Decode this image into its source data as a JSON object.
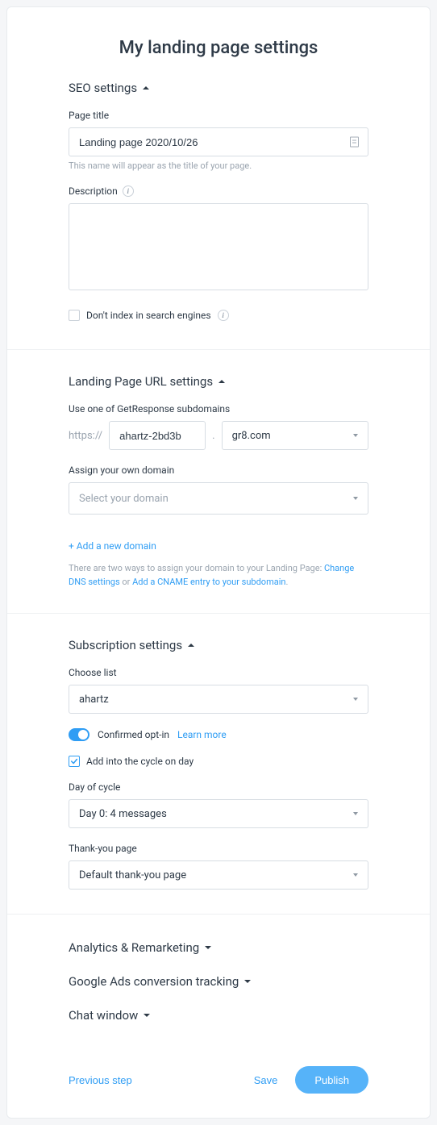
{
  "page_title": "My landing page settings",
  "seo": {
    "heading": "SEO settings",
    "page_title_label": "Page title",
    "page_title_value": "Landing page 2020/10/26",
    "page_title_hint": "This name will appear as the title of your page.",
    "description_label": "Description",
    "description_value": "",
    "noindex_label": "Don't index in search engines",
    "noindex_checked": false
  },
  "url": {
    "heading": "Landing Page URL settings",
    "subdomain_label": "Use one of GetResponse subdomains",
    "protocol": "https://",
    "subdomain_value": "ahartz-2bd3b",
    "domain_value": "gr8.com",
    "own_domain_label": "Assign your own domain",
    "own_domain_placeholder": "Select your domain",
    "add_domain_link": "+ Add a new domain",
    "help_text_1": "There are two ways to assign your domain to your Landing Page: ",
    "help_link_1": "Change DNS settings",
    "help_text_2": " or ",
    "help_link_2": "Add a CNAME entry to your subdomain",
    "help_text_3": "."
  },
  "subscription": {
    "heading": "Subscription settings",
    "choose_list_label": "Choose list",
    "choose_list_value": "ahartz",
    "confirmed_optin_label": "Confirmed opt-in",
    "learn_more": "Learn more",
    "cycle_label": "Add into the cycle on day",
    "cycle_checked": true,
    "day_of_cycle_label": "Day of cycle",
    "day_of_cycle_value": "Day 0: 4 messages",
    "thank_you_label": "Thank-you page",
    "thank_you_value": "Default thank-you page"
  },
  "collapsed": {
    "analytics": "Analytics & Remarketing",
    "google_ads": "Google Ads conversion tracking",
    "chat": "Chat window"
  },
  "footer": {
    "previous": "Previous step",
    "save": "Save",
    "publish": "Publish"
  }
}
